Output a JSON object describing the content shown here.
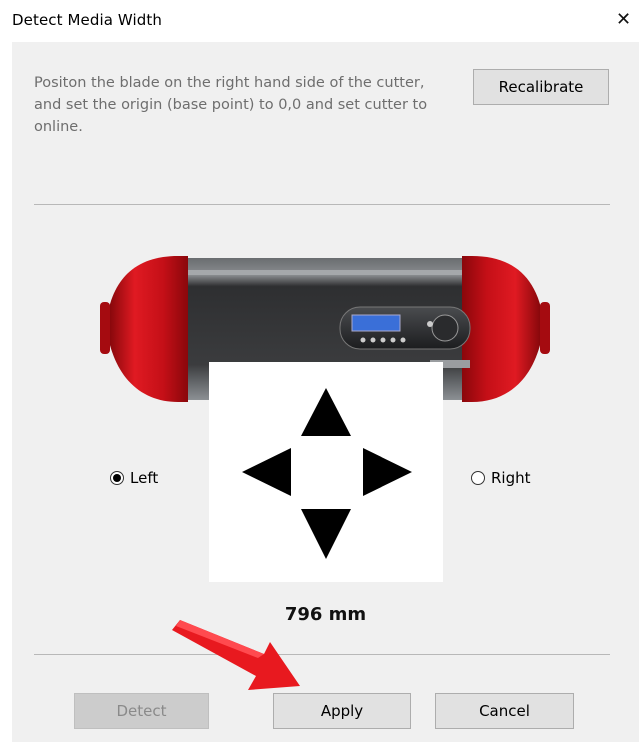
{
  "window": {
    "title": "Detect Media Width",
    "close_glyph": "✕"
  },
  "instructions": "Positon the blade on the right hand side of the cutter, and set the origin (base point) to 0,0 and set cutter to online.",
  "buttons": {
    "recalibrate": "Recalibrate",
    "detect": "Detect",
    "apply": "Apply",
    "cancel": "Cancel"
  },
  "position": {
    "left_label": "Left",
    "right_label": "Right",
    "selected": "Left"
  },
  "media_width": "796 mm",
  "icons": {
    "cutter": "vinyl-cutter-image",
    "jog": "direction-arrows-icon",
    "annotation": "red-arrow-pointer"
  },
  "colors": {
    "dialog_bg": "#f0f0f0",
    "cutter_red": "#d4121b",
    "cutter_body": "#3a3a3a",
    "annotation_arrow": "#e8191f"
  }
}
